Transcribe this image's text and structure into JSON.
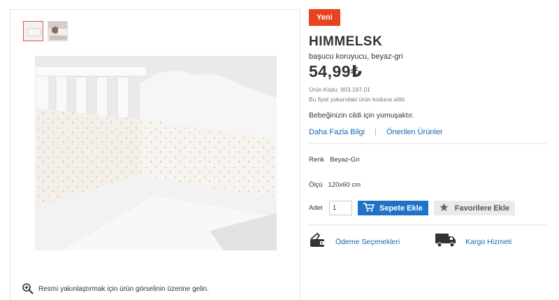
{
  "gallery": {
    "zoom_hint": "Resmi yakınlaştırmak için ürün görselinin üzerine gelin."
  },
  "product": {
    "badge": "Yeni",
    "name": "HIMMELSK",
    "subtitle": "başucu koruyucu, beyaz-gri",
    "price": "54,99₺",
    "code": "Ürün Kodu: 903.197.01",
    "price_note": "Bu fiyat yukarıdaki ürün koduna aittir.",
    "description": "Bebeğinizin cildi için yumuşaktır.",
    "links": {
      "more_info": "Daha Fazla Bilgi",
      "separator": "|",
      "recommended": "Önerilen Ürünler"
    },
    "color_label": "Renk",
    "color_value": "Beyaz-Gri",
    "size_label": "Ölçü",
    "size_value": "120x60 cm",
    "quantity_label": "Adet",
    "quantity_value": "1",
    "add_to_cart": "Sepete Ekle",
    "add_to_favorites": "Favorilere Ekle"
  },
  "services": {
    "payment": "Ödeme Seçenekleri",
    "shipping": "Kargo Hizmeti"
  },
  "colors": {
    "badge": "#e8421f",
    "primary_button": "#1f73c7",
    "link": "#1565b6",
    "icon_dark": "#333333"
  },
  "icons": [
    "zoom-in-icon",
    "cart-icon",
    "star-icon",
    "wallet-icon",
    "truck-icon"
  ]
}
